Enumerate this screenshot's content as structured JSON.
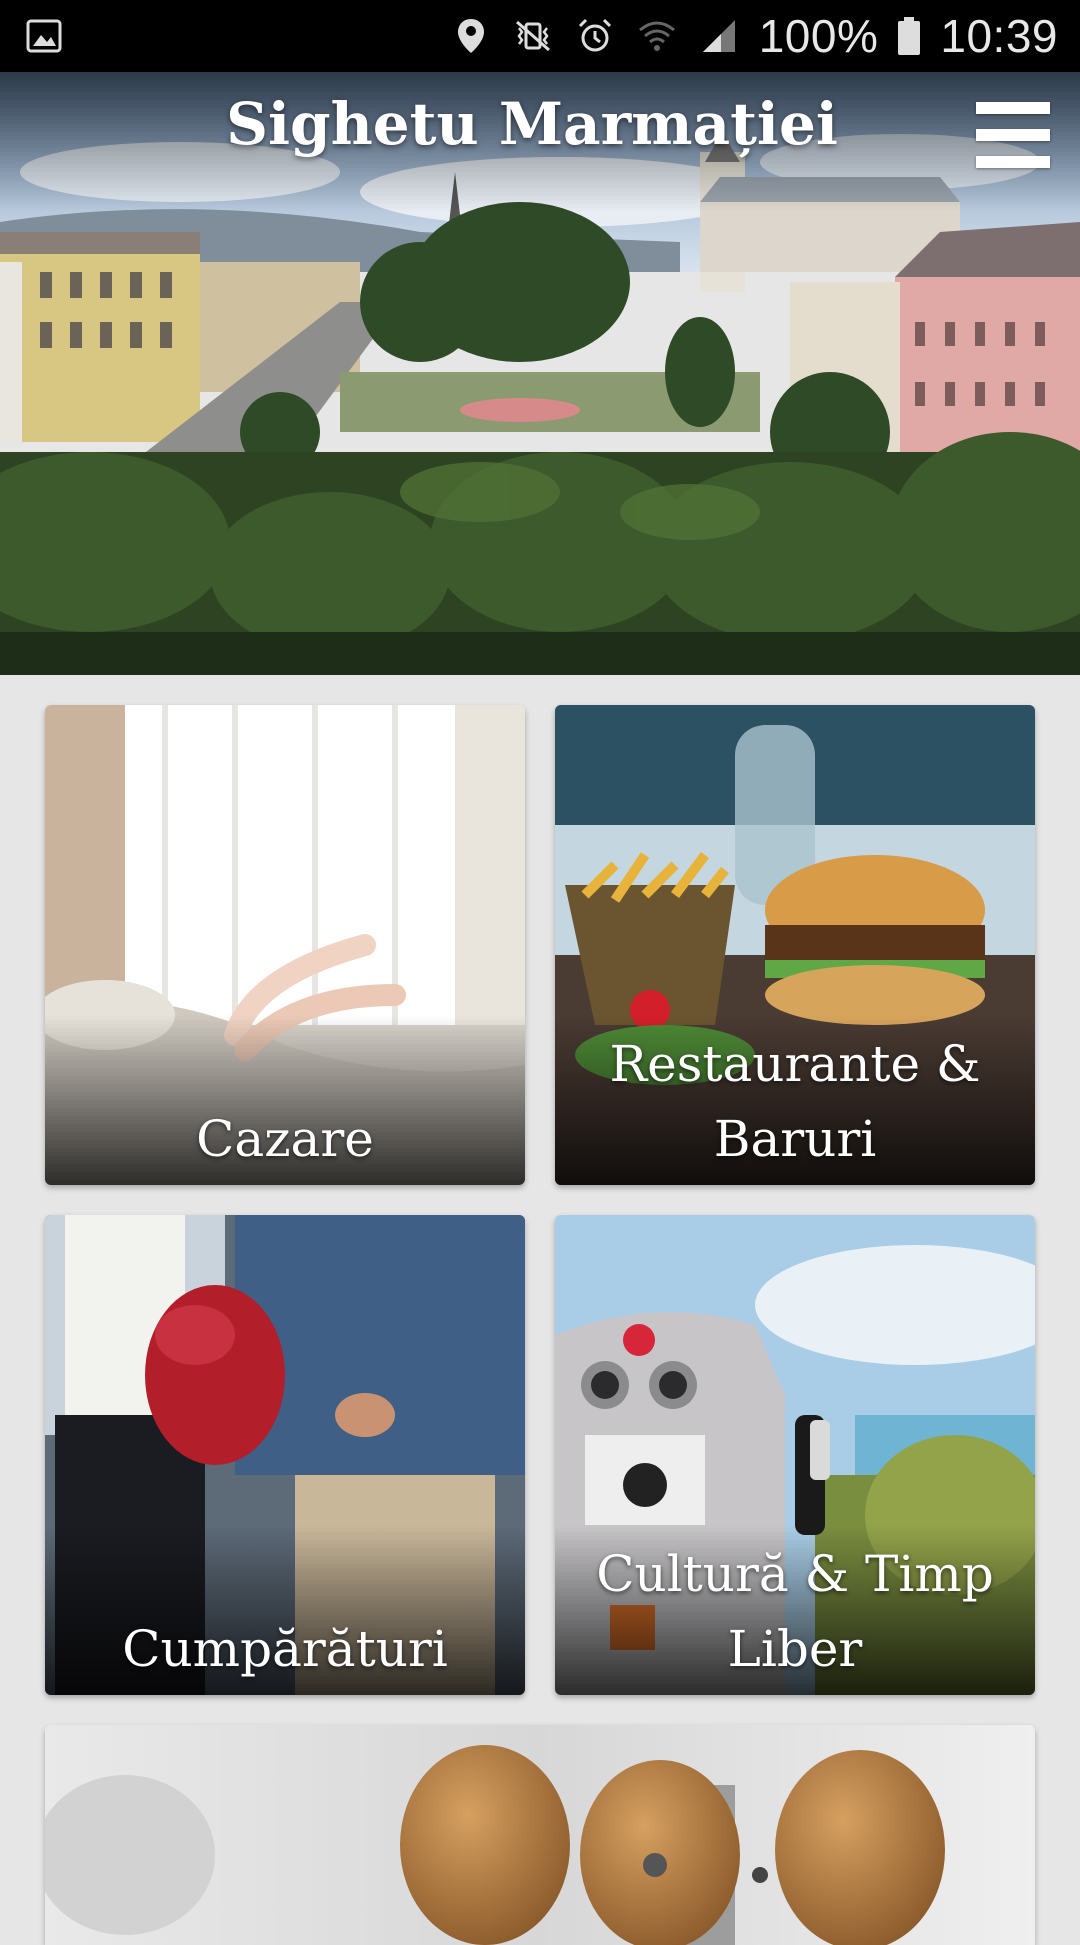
{
  "status_bar": {
    "battery": "100%",
    "time": "10:39",
    "icons": [
      "gallery-icon",
      "location-icon",
      "vibrate-icon",
      "alarm-icon",
      "wifi-icon",
      "signal-icon",
      "battery-icon"
    ]
  },
  "header": {
    "title": "Sighetu Marmației",
    "menu_icon": "hamburger-menu-icon"
  },
  "categories": [
    {
      "label": "Cazare"
    },
    {
      "label": "Restaurante & Baruri"
    },
    {
      "label": "Cumpărături"
    },
    {
      "label": "Cultură & Timp Liber"
    },
    {
      "label": ""
    }
  ],
  "colors": {
    "background": "#e6e6e6",
    "status_bar": "#000000",
    "text": "#ffffff"
  }
}
